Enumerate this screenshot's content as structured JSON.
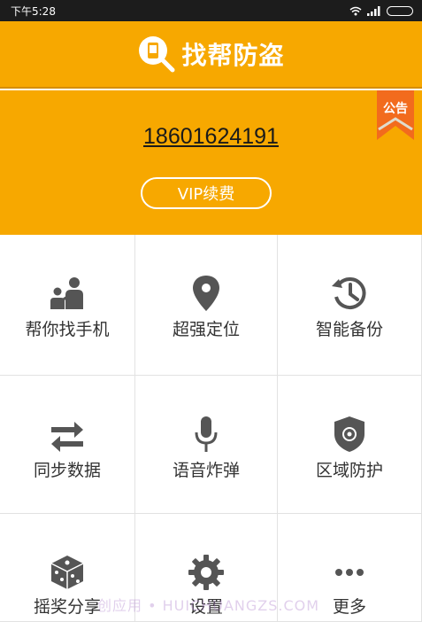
{
  "status_bar": {
    "time": "下午5:28"
  },
  "header": {
    "title": "找帮防盗"
  },
  "hero": {
    "phone_number": "18601624191",
    "vip_button_label": "VIP续费",
    "notice_label": "公告"
  },
  "grid": [
    {
      "label": "帮你找手机",
      "icon": "people-icon"
    },
    {
      "label": "超强定位",
      "icon": "location-pin-icon"
    },
    {
      "label": "智能备份",
      "icon": "history-icon"
    },
    {
      "label": "同步数据",
      "icon": "sync-arrows-icon"
    },
    {
      "label": "语音炸弹",
      "icon": "microphone-icon"
    },
    {
      "label": "区域防护",
      "icon": "shield-icon"
    },
    {
      "label": "摇奖分享",
      "icon": "dice-icon"
    },
    {
      "label": "设置",
      "icon": "gear-icon"
    },
    {
      "label": "更多",
      "icon": "more-dots-icon"
    }
  ],
  "colors": {
    "accent": "#f7a800",
    "icon": "#555555",
    "ribbon": "#f26b1d"
  },
  "watermark": "创应用 • HUICHUANGZS.COM"
}
